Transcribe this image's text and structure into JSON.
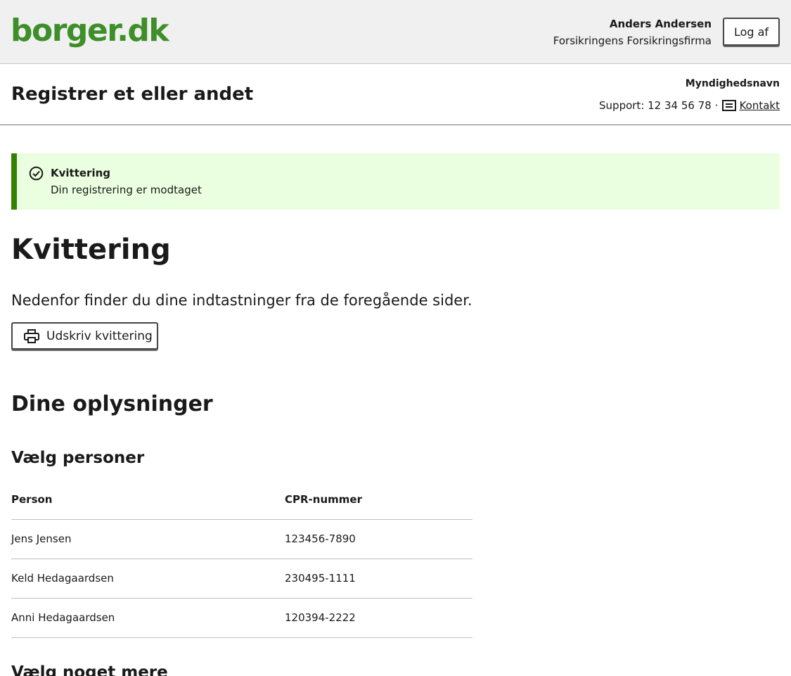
{
  "header": {
    "logo_text": "borger.dk",
    "user_name": "Anders Andersen",
    "user_org": "Forsikringens Forsikringsfirma",
    "logout_label": "Log af"
  },
  "subheader": {
    "title": "Registrer et eller andet",
    "authority": "Myndighedsnavn",
    "support_text": "Support: 12 34 56 78",
    "separator": "·",
    "contact_label": "Kontakt",
    "contact_icon": "message-lines-icon"
  },
  "alert": {
    "icon": "check-circle-icon",
    "title": "Kvittering",
    "text": "Din registrering er modtaget",
    "accent_color": "#358000",
    "background_color": "#eaffdf"
  },
  "main": {
    "heading": "Kvittering",
    "intro": "Nedenfor finder du dine indtastninger fra de foregående sider.",
    "print_button_label": "Udskriv kvittering",
    "print_icon": "printer-icon",
    "section_heading": "Dine oplysninger",
    "subsection_heading": "Vælg personer",
    "next_subsection_heading": "Vælg noget mere"
  },
  "persons_table": {
    "headers": [
      "Person",
      "CPR-nummer"
    ],
    "rows": [
      [
        "Jens Jensen",
        "123456-7890"
      ],
      [
        "Keld Hedagaardsen",
        "230495-1111"
      ],
      [
        "Anni Hedagaardsen",
        "120394-2222"
      ]
    ]
  },
  "colors": {
    "brand_green": "#3e8e2a",
    "header_bg": "#f0f0f0"
  }
}
